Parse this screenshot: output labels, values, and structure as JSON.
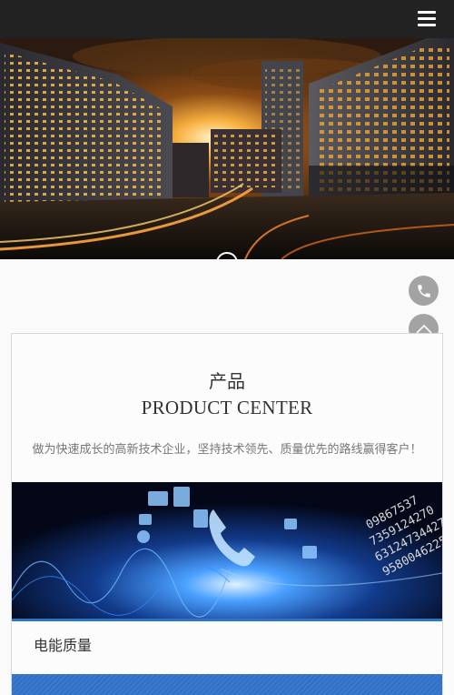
{
  "header": {
    "menu_icon": "hamburger-menu-icon"
  },
  "hero": {
    "image": "city-skyline-sunset-photo",
    "scroll_icon": "mouse-scroll-icon"
  },
  "floating": {
    "phone_icon": "phone-icon",
    "top_icon": "chevron-up-icon"
  },
  "section": {
    "title_cn": "产品",
    "title_en": "PRODUCT CENTER",
    "description": "做为快速成长的高新技术企业，坚持技术领先、质量优先的路线赢得客户！"
  },
  "products": [
    {
      "name": "电能质量",
      "image": "blue-tech-telecom-photo"
    }
  ],
  "colors": {
    "topbar": "#222222",
    "accent": "#2a73c9",
    "float_button": "#9a9a9a"
  }
}
